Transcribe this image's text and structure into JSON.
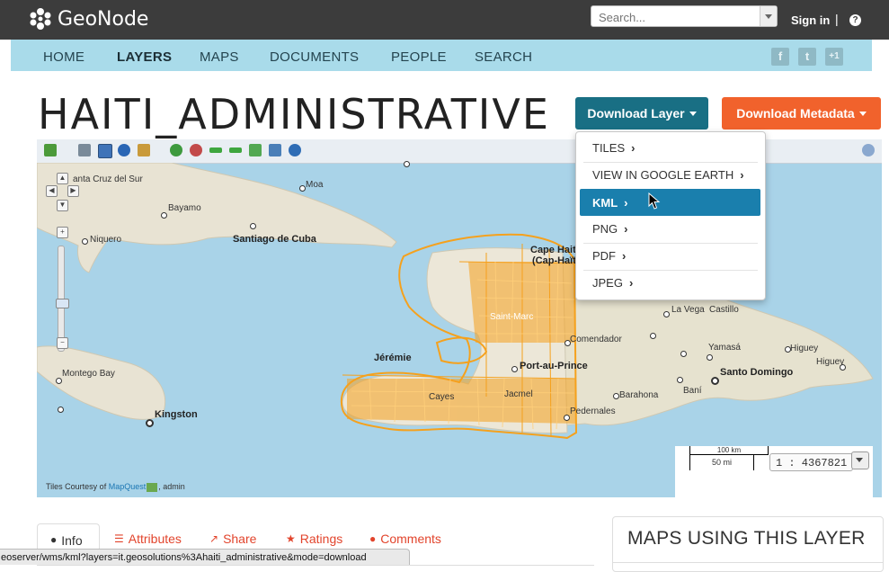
{
  "header": {
    "brand": "GeoNode",
    "search_placeholder": "Search...",
    "signin": "Sign in",
    "separator": "|",
    "help_glyph": "?"
  },
  "nav": {
    "items": [
      "HOME",
      "LAYERS",
      "MAPS",
      "DOCUMENTS",
      "PEOPLE",
      "SEARCH"
    ],
    "active": "LAYERS",
    "social": [
      "f",
      "t",
      "+1"
    ]
  },
  "layer": {
    "title": "HAITI_ADMINISTRATIVE",
    "download_layer": "Download Layer",
    "download_metadata": "Download Metadata"
  },
  "download_menu": {
    "items": [
      "TILES",
      "VIEW IN GOOGLE EARTH",
      "KML",
      "PNG",
      "PDF",
      "JPEG"
    ],
    "selected": "KML"
  },
  "map": {
    "places": {
      "santa_cruz": "anta Cruz del Sur",
      "moa": "Moa",
      "bayamo": "Bayamo",
      "niquero": "Niquero",
      "santiago": "Santiago de Cuba",
      "cape_haitien": "Cape Haitien",
      "cap_haitien": "(Cap-Haïtien)",
      "saint_marc": "Saint-Marc",
      "jeremie": "Jérémie",
      "port_au_prince": "Port-au-Prince",
      "cayes": "Cayes",
      "jacmel": "Jacmel",
      "comendador": "Comendador",
      "la_vega": "La Vega",
      "castillo": "Castillo",
      "yamasa": "Yamasá",
      "higuey": "Higuey",
      "santo_domingo": "Santo Domingo",
      "bani": "Baní",
      "barahona": "Barahona",
      "pedernales": "Pedernales",
      "montego_bay": "Montego Bay",
      "kingston": "Kingston"
    },
    "credit_prefix": "Tiles Courtesy of ",
    "credit_link": "MapQuest",
    "credit_suffix": ", admin",
    "scale_top": "100 km",
    "scale_bottom": "50 mi",
    "scale_ratio": "1 : 4367821",
    "colors": {
      "water": "#a9d3e8",
      "land": "#e8e3d3",
      "layer": "#f5a11d"
    }
  },
  "tabs": {
    "info": "Info",
    "attributes": "Attributes",
    "share": "Share",
    "ratings": "Ratings",
    "comments": "Comments"
  },
  "sidebar": {
    "maps_using": "MAPS USING THIS LAYER"
  },
  "status_url": "eoserver/wms/kml?layers=it.geosolutions%3Ahaiti_administrative&mode=download"
}
